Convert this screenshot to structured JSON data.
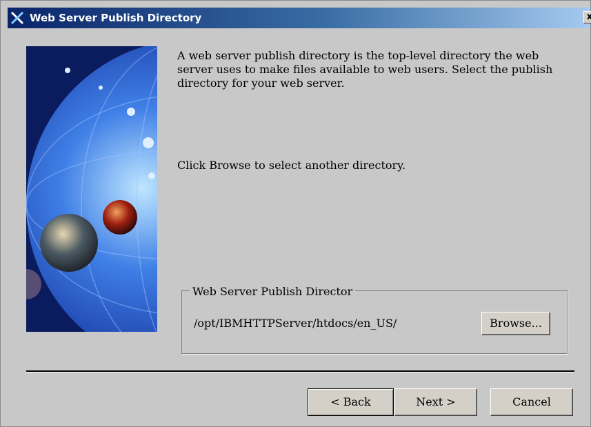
{
  "window": {
    "title": "Web Server Publish Directory",
    "app_icon": "x-logo-icon",
    "close_label": "x"
  },
  "content": {
    "description": "A web server publish directory is the top-level directory the web server uses to make files available to web users.  Select the publish directory for your web server.",
    "hint": "Click Browse to select another directory.",
    "group_label": "Web Server Publish Director",
    "directory_path": "/opt/IBMHTTPServer/htdocs/en_US/",
    "browse_label": "Browse..."
  },
  "footer": {
    "back_label": "< Back",
    "next_label": "Next >",
    "cancel_label": "Cancel"
  },
  "colors": {
    "dialog_background": "#c8c8c8",
    "titlebar_start": "#0a246a",
    "titlebar_end": "#a6caf0",
    "title_text": "#ffffff"
  }
}
